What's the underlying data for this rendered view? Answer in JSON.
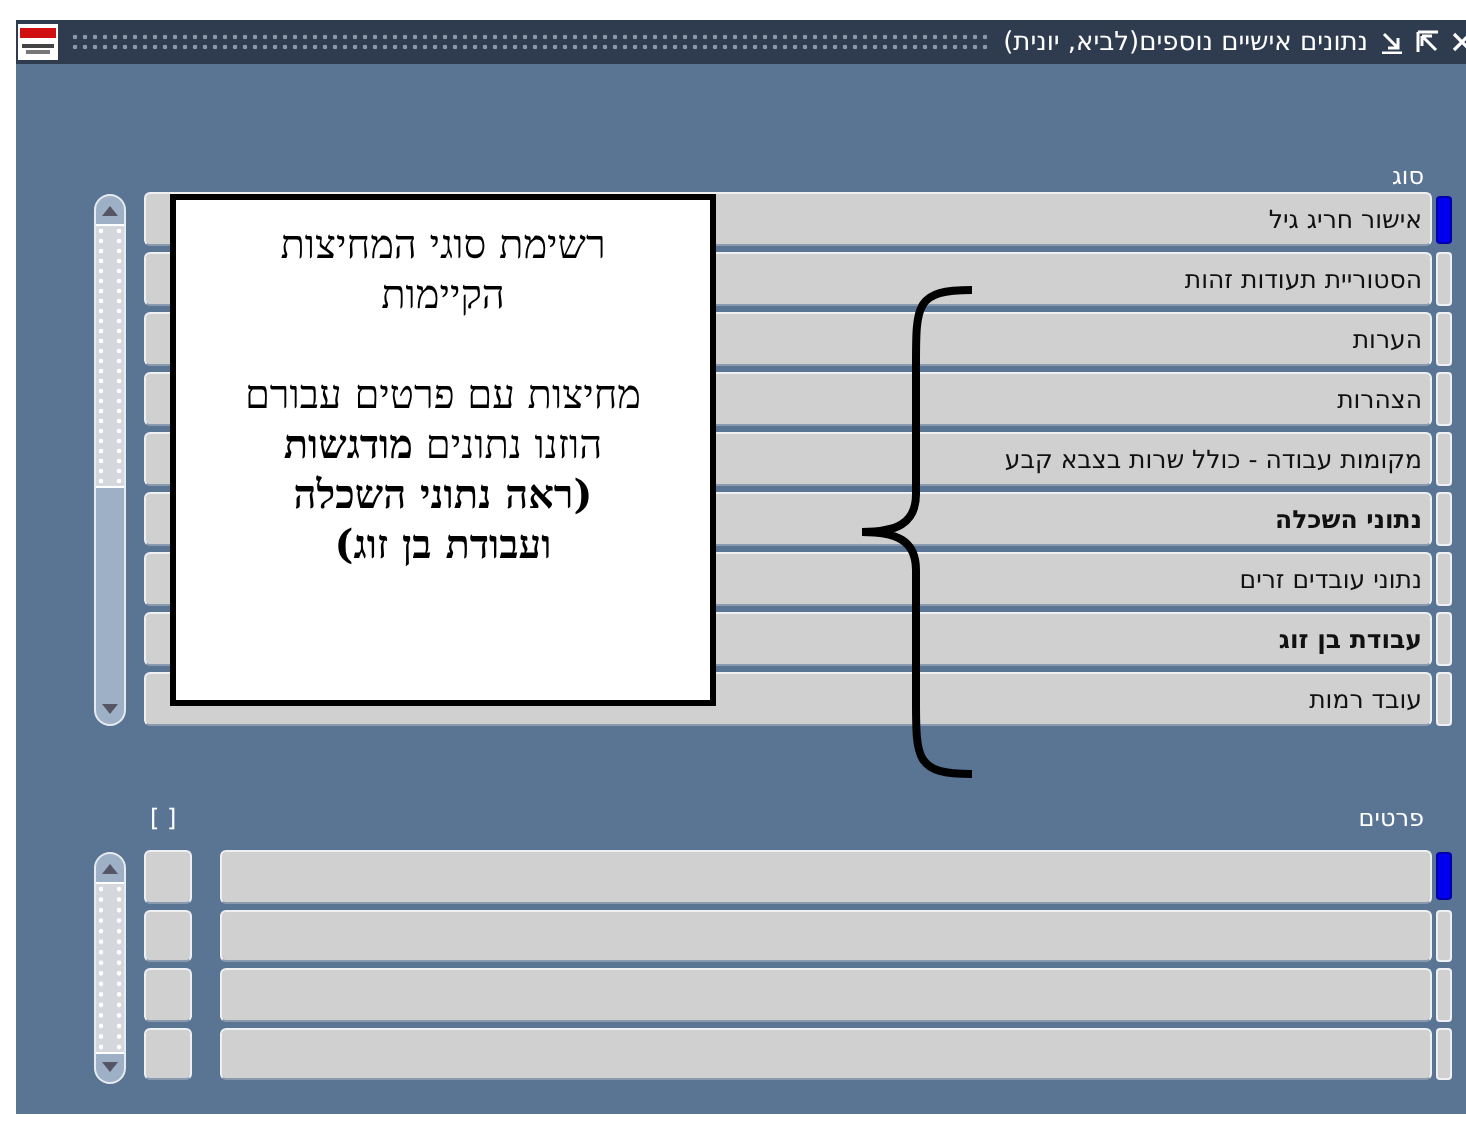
{
  "window": {
    "title": "נתונים אישיים נוספים(לביא, יונית)"
  },
  "types": {
    "label": "סוג",
    "rows": [
      {
        "value": "אישור חריג גיל",
        "bold": false,
        "selected": true
      },
      {
        "value": "הסטוריית תעודות זהות",
        "bold": false,
        "selected": false
      },
      {
        "value": "הערות",
        "bold": false,
        "selected": false
      },
      {
        "value": "הצהרות",
        "bold": false,
        "selected": false
      },
      {
        "value": "מקומות עבודה - כולל שרות בצבא קבע",
        "bold": false,
        "selected": false
      },
      {
        "value": "נתוני השכלה",
        "bold": true,
        "selected": false
      },
      {
        "value": "נתוני עובדים זרים",
        "bold": false,
        "selected": false
      },
      {
        "value": "עבודת בן זוג",
        "bold": true,
        "selected": false
      },
      {
        "value": "עובד רמות",
        "bold": false,
        "selected": false
      }
    ]
  },
  "details": {
    "label": "פרטים",
    "check_label": "[ ]",
    "rows": [
      {
        "selected": true
      },
      {
        "selected": false
      },
      {
        "selected": false
      },
      {
        "selected": false
      }
    ]
  },
  "callout": {
    "heading": "רשימת סוגי המחיצות הקיימות",
    "note": "מחיצות עם פרטים עבורם הוזנו נתונים **מודגשות (ראה נתוני השכלה ועבודת בן זוג)**"
  }
}
